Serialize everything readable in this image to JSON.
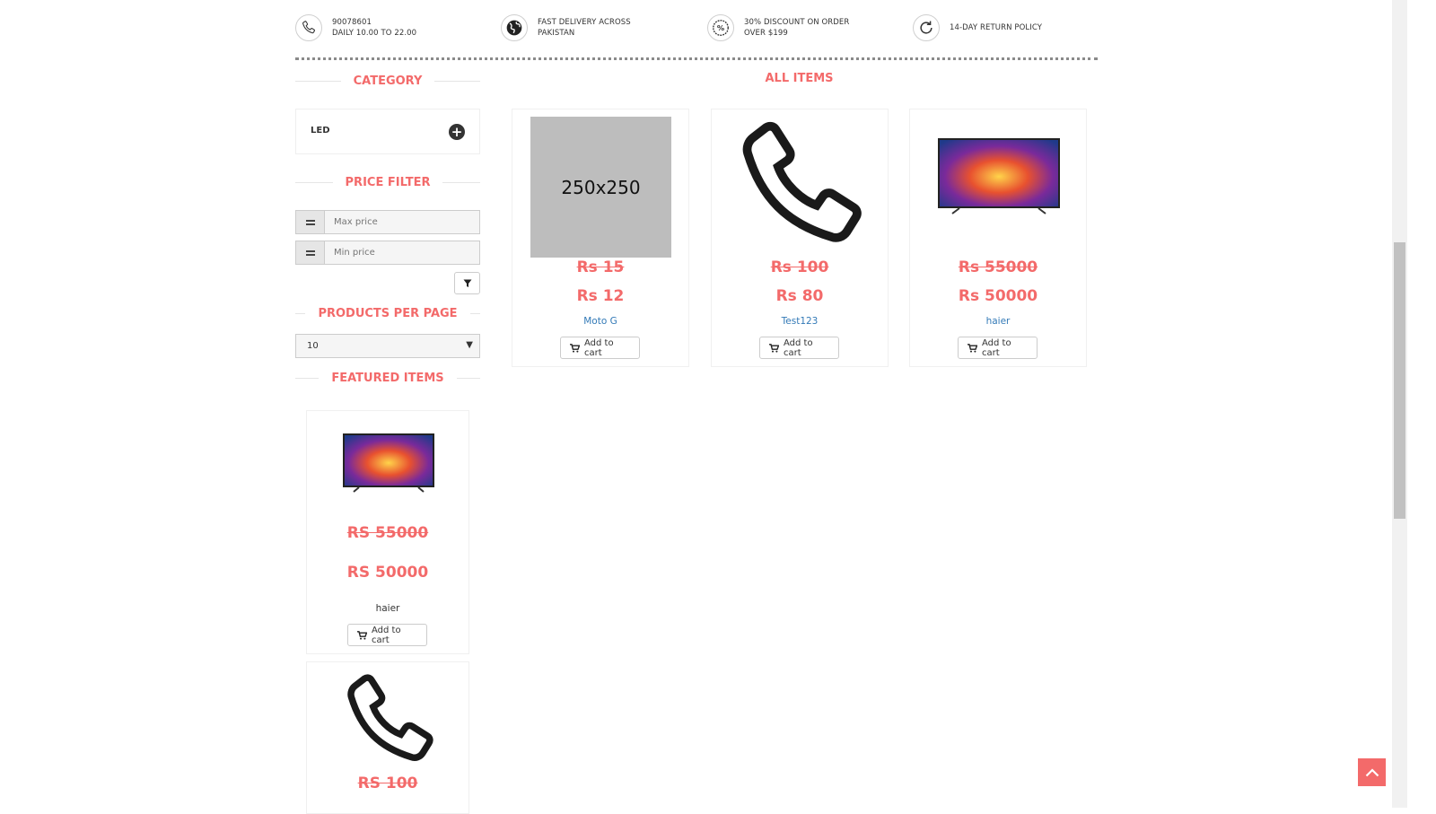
{
  "features": [
    {
      "icon": "phone-icon",
      "line1": "90078601",
      "line2": "DAILY 10.00 TO 22.00"
    },
    {
      "icon": "globe-icon",
      "line1": "FAST DELIVERY ACROSS",
      "line2": "PAKISTAN"
    },
    {
      "icon": "discount-icon",
      "line1": "30% DISCOUNT ON ORDER",
      "line2": "OVER $199"
    },
    {
      "icon": "return-icon",
      "line1": "14-DAY RETURN POLICY",
      "line2": ""
    }
  ],
  "sidebar": {
    "category_heading": "CATEGORY",
    "categories": [
      {
        "label": "LED",
        "icon": "plus-circle-icon"
      }
    ],
    "price_filter_heading": "PRICE FILTER",
    "max_price_placeholder": "Max price",
    "min_price_placeholder": "Min price",
    "per_page_heading": "PRODUCTS PER PAGE",
    "per_page_value": "10",
    "featured_heading": "FEATURED ITEMS",
    "featured": [
      {
        "image": "tv-image",
        "old_price": "RS 55000",
        "new_price": "RS 50000",
        "name": "haier",
        "button": "Add to cart"
      },
      {
        "image": "phone-image",
        "old_price": "RS 100"
      }
    ]
  },
  "main": {
    "heading": "ALL ITEMS",
    "products": [
      {
        "image_text": "250x250",
        "old_price": "Rs 15",
        "new_price": "Rs 12",
        "name": "Moto G",
        "button": "Add to cart"
      },
      {
        "image": "phone-image",
        "old_price": "Rs 100",
        "new_price": "Rs 80",
        "name": "Test123",
        "button": "Add to cart"
      },
      {
        "image": "tv-image",
        "old_price": "Rs 55000",
        "new_price": "Rs 50000",
        "name": "haier",
        "button": "Add to cart"
      }
    ]
  },
  "colors": {
    "accent": "#f36a6a",
    "link": "#337ab7"
  }
}
